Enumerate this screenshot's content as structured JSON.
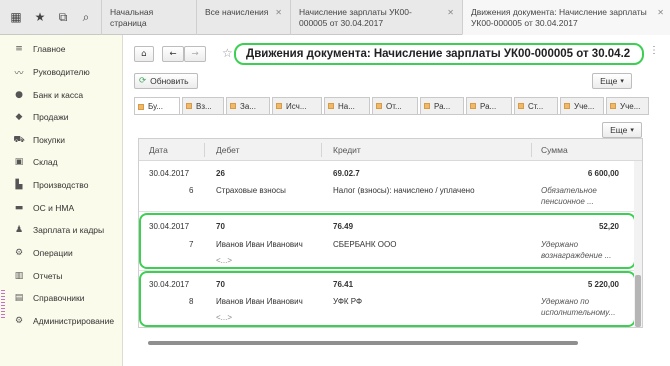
{
  "tabs": [
    {
      "label": "Начальная страница"
    },
    {
      "label": "Все начисления"
    },
    {
      "label": "Начисление зарплаты УК00-000005 от 30.04.2017"
    },
    {
      "label": "Движения документа: Начисление зарплаты УК00-000005 от 30.04.2017"
    }
  ],
  "sidebar": {
    "items": [
      {
        "label": "Главное",
        "icon": "menu-icon"
      },
      {
        "label": "Руководителю",
        "icon": "chart-line-icon"
      },
      {
        "label": "Банк и касса",
        "icon": "coin-icon"
      },
      {
        "label": "Продажи",
        "icon": "bag-icon"
      },
      {
        "label": "Покупки",
        "icon": "cart-icon"
      },
      {
        "label": "Склад",
        "icon": "warehouse-icon"
      },
      {
        "label": "Производство",
        "icon": "factory-icon"
      },
      {
        "label": "ОС и НМА",
        "icon": "truck-icon"
      },
      {
        "label": "Зарплата и кадры",
        "icon": "person-icon"
      },
      {
        "label": "Операции",
        "icon": "gears-icon"
      },
      {
        "label": "Отчеты",
        "icon": "bar-chart-icon"
      },
      {
        "label": "Справочники",
        "icon": "book-icon"
      },
      {
        "label": "Администрирование",
        "icon": "gear-icon"
      }
    ]
  },
  "header": {
    "title": "Движения документа: Начисление зарплаты УК00-000005 от 30.04.2",
    "refresh_label": "Обновить",
    "more_label": "Еще",
    "table_more_label": "Еще"
  },
  "section_tabs": [
    {
      "label": "Бу..."
    },
    {
      "label": "Вз..."
    },
    {
      "label": "За..."
    },
    {
      "label": "Исч..."
    },
    {
      "label": "На..."
    },
    {
      "label": "От..."
    },
    {
      "label": "Ра..."
    },
    {
      "label": "Ра..."
    },
    {
      "label": "Ст..."
    },
    {
      "label": "Уче..."
    },
    {
      "label": "Уче..."
    }
  ],
  "table": {
    "columns": [
      "Дата",
      "Дебет",
      "Кредит",
      "Сумма"
    ],
    "rows": [
      {
        "date": "30.04.2017",
        "num": "6",
        "debit_account": "26",
        "debit_sub": "Страховые взносы",
        "debit_extra": "",
        "credit_account": "69.02.7",
        "credit_sub": "Налог (взносы): начислено / уплачено",
        "sum": "6 600,00",
        "sum_note": "Обязательное пенсионное ..."
      },
      {
        "date": "30.04.2017",
        "num": "7",
        "debit_account": "70",
        "debit_sub": "Иванов Иван Иванович",
        "debit_extra": "<...>",
        "credit_account": "76.49",
        "credit_sub": "СБЕРБАНК ООО",
        "sum": "52,20",
        "sum_note": "Удержано вознаграждение ..."
      },
      {
        "date": "30.04.2017",
        "num": "8",
        "debit_account": "70",
        "debit_sub": "Иванов Иван Иванович",
        "debit_extra": "<...>",
        "credit_account": "76.41",
        "credit_sub": "УФК РФ",
        "sum": "5 220,00",
        "sum_note": "Удержано по исполнительному..."
      }
    ]
  },
  "colors": {
    "highlight": "#3dcf53",
    "sidebar_bg": "#fbfbeb",
    "tab_marker": "#f0b86a"
  }
}
